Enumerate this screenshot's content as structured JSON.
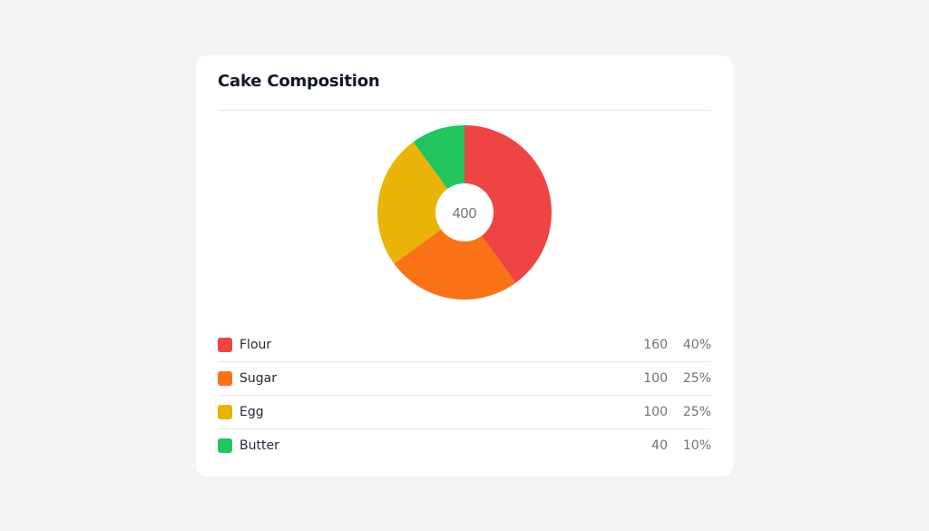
{
  "card": {
    "title": "Cake Composition"
  },
  "chart_data": {
    "type": "pie",
    "title": "Cake Composition",
    "center_label": "400",
    "slices": [
      {
        "label": "Flour",
        "value": 160,
        "percent": "40%",
        "color": "#ef4444"
      },
      {
        "label": "Sugar",
        "value": 100,
        "percent": "25%",
        "color": "#f97316"
      },
      {
        "label": "Egg",
        "value": 100,
        "percent": "25%",
        "color": "#eab308"
      },
      {
        "label": "Butter",
        "value": 40,
        "percent": "10%",
        "color": "#22c55e"
      }
    ]
  }
}
